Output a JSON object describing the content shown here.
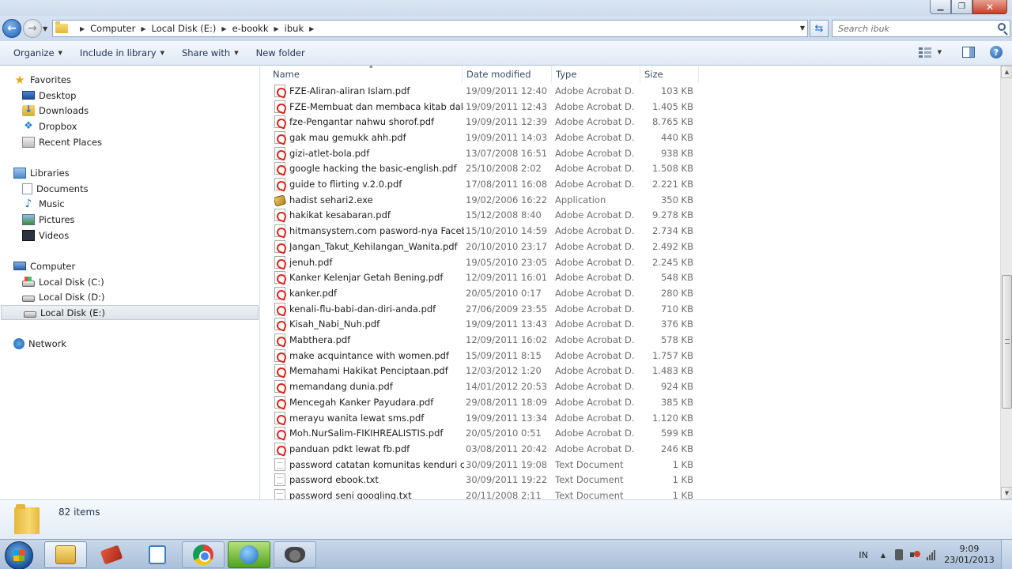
{
  "titlebar": {
    "buttons": [
      "minimize-icon",
      "maximize-icon",
      "close-icon"
    ],
    "close_glyph": "✕"
  },
  "address": {
    "breadcrumbs": [
      "Computer",
      "Local Disk (E:)",
      "e-bookk",
      "ibuk"
    ],
    "search_placeholder": "Search ibuk"
  },
  "toolbar": {
    "organize": "Organize",
    "include_in_library": "Include in library",
    "share_with": "Share with",
    "new_folder": "New folder"
  },
  "navpane": {
    "favorites": "Favorites",
    "desktop": "Desktop",
    "downloads": "Downloads",
    "dropbox": "Dropbox",
    "recent_places": "Recent Places",
    "libraries": "Libraries",
    "documents": "Documents",
    "music": "Music",
    "pictures": "Pictures",
    "videos": "Videos",
    "computer": "Computer",
    "disk_c": "Local Disk (C:)",
    "disk_d": "Local Disk (D:)",
    "disk_e": "Local Disk (E:)",
    "network": "Network",
    "selected": "disk_e"
  },
  "columns": {
    "name": "Name",
    "date_modified": "Date modified",
    "type": "Type",
    "size": "Size"
  },
  "files": [
    {
      "name": "FZE-Aliran-aliran Islam.pdf",
      "date": "19/09/2011 12:40",
      "type": "Adobe Acrobat D...",
      "size": "103 KB",
      "icon": "pdf"
    },
    {
      "name": "FZE-Membuat dan membaca kitab dala...",
      "date": "19/09/2011 12:43",
      "type": "Adobe Acrobat D...",
      "size": "1.405 KB",
      "icon": "pdf"
    },
    {
      "name": "fze-Pengantar nahwu shorof.pdf",
      "date": "19/09/2011 12:39",
      "type": "Adobe Acrobat D...",
      "size": "8.765 KB",
      "icon": "pdf"
    },
    {
      "name": "gak mau gemukk ahh.pdf",
      "date": "19/09/2011 14:03",
      "type": "Adobe Acrobat D...",
      "size": "440 KB",
      "icon": "pdf"
    },
    {
      "name": "gizi-atlet-bola.pdf",
      "date": "13/07/2008 16:51",
      "type": "Adobe Acrobat D...",
      "size": "938 KB",
      "icon": "pdf"
    },
    {
      "name": "google hacking the basic-english.pdf",
      "date": "25/10/2008 2:02",
      "type": "Adobe Acrobat D...",
      "size": "1.508 KB",
      "icon": "pdf"
    },
    {
      "name": "guide to flirting v.2.0.pdf",
      "date": "17/08/2011 16:08",
      "type": "Adobe Acrobat D...",
      "size": "2.221 KB",
      "icon": "pdf"
    },
    {
      "name": "hadist sehari2.exe",
      "date": "19/02/2006 16:22",
      "type": "Application",
      "size": "350 KB",
      "icon": "exe"
    },
    {
      "name": "hakikat kesabaran.pdf",
      "date": "15/12/2008 8:40",
      "type": "Adobe Acrobat D...",
      "size": "9.278 KB",
      "icon": "pdf"
    },
    {
      "name": "hitmansystem.com pasword-nya Facebo...",
      "date": "15/10/2010 14:59",
      "type": "Adobe Acrobat D...",
      "size": "2.734 KB",
      "icon": "pdf"
    },
    {
      "name": "Jangan_Takut_Kehilangan_Wanita.pdf",
      "date": "20/10/2010 23:17",
      "type": "Adobe Acrobat D...",
      "size": "2.492 KB",
      "icon": "pdf"
    },
    {
      "name": "jenuh.pdf",
      "date": "19/05/2010 23:05",
      "type": "Adobe Acrobat D...",
      "size": "2.245 KB",
      "icon": "pdf"
    },
    {
      "name": "Kanker Kelenjar Getah Bening.pdf",
      "date": "12/09/2011 16:01",
      "type": "Adobe Acrobat D...",
      "size": "548 KB",
      "icon": "pdf"
    },
    {
      "name": "kanker.pdf",
      "date": "20/05/2010 0:17",
      "type": "Adobe Acrobat D...",
      "size": "280 KB",
      "icon": "pdf"
    },
    {
      "name": "kenali-flu-babi-dan-diri-anda.pdf",
      "date": "27/06/2009 23:55",
      "type": "Adobe Acrobat D...",
      "size": "710 KB",
      "icon": "pdf"
    },
    {
      "name": "Kisah_Nabi_Nuh.pdf",
      "date": "19/09/2011 13:43",
      "type": "Adobe Acrobat D...",
      "size": "376 KB",
      "icon": "pdf"
    },
    {
      "name": "Mabthera.pdf",
      "date": "12/09/2011 16:02",
      "type": "Adobe Acrobat D...",
      "size": "578 KB",
      "icon": "pdf"
    },
    {
      "name": "make acquintance with women.pdf",
      "date": "15/09/2011 8:15",
      "type": "Adobe Acrobat D...",
      "size": "1.757 KB",
      "icon": "pdf"
    },
    {
      "name": "Memahami Hakikat Penciptaan.pdf",
      "date": "12/03/2012 1:20",
      "type": "Adobe Acrobat D...",
      "size": "1.483 KB",
      "icon": "pdf"
    },
    {
      "name": "memandang dunia.pdf",
      "date": "14/01/2012 20:53",
      "type": "Adobe Acrobat D...",
      "size": "924 KB",
      "icon": "pdf"
    },
    {
      "name": "Mencegah Kanker Payudara.pdf",
      "date": "29/08/2011 18:09",
      "type": "Adobe Acrobat D...",
      "size": "385 KB",
      "icon": "pdf"
    },
    {
      "name": "merayu wanita lewat sms.pdf",
      "date": "19/09/2011 13:34",
      "type": "Adobe Acrobat D...",
      "size": "1.120 KB",
      "icon": "pdf"
    },
    {
      "name": "Moh.NurSalim-FIKIHREALISTIS.pdf",
      "date": "20/05/2010 0:51",
      "type": "Adobe Acrobat D...",
      "size": "599 KB",
      "icon": "pdf"
    },
    {
      "name": "panduan pdkt lewat fb.pdf",
      "date": "03/08/2011 20:42",
      "type": "Adobe Acrobat D...",
      "size": "246 KB",
      "icon": "pdf"
    },
    {
      "name": "password catatan komunitas kenduri cint...",
      "date": "30/09/2011 19:08",
      "type": "Text Document",
      "size": "1 KB",
      "icon": "txt"
    },
    {
      "name": "password ebook.txt",
      "date": "30/09/2011 19:22",
      "type": "Text Document",
      "size": "1 KB",
      "icon": "txt"
    },
    {
      "name": "password seni googling.txt",
      "date": "20/11/2008 2:11",
      "type": "Text Document",
      "size": "1 KB",
      "icon": "txt"
    }
  ],
  "details": {
    "item_count": "82 items"
  },
  "taskbar": {
    "apps": [
      "explorer-icon",
      "book-icon",
      "notepad-icon",
      "chrome-icon",
      "globe-icon",
      "gimp-icon"
    ],
    "language": "IN",
    "time": "9:09",
    "date": "23/01/2013"
  },
  "colors": {
    "pdf_red": "#d8271c",
    "muted_text": "#6d6d6d",
    "header_text": "#3a4c66"
  }
}
